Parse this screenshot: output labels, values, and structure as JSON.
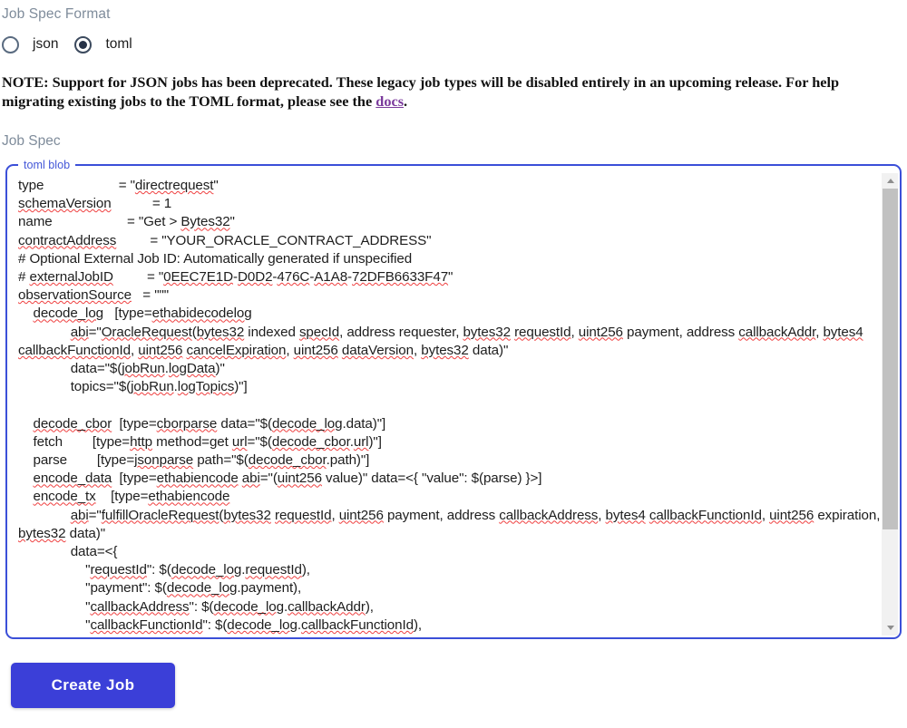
{
  "form": {
    "format_label": "Job Spec Format",
    "radios": [
      {
        "value": "json",
        "label": "json",
        "checked": false
      },
      {
        "value": "toml",
        "label": "toml",
        "checked": true
      }
    ],
    "note_part1": "NOTE: Support for JSON jobs has been deprecated. These legacy job types will be disabled entirely in an upcoming release. For help migrating existing jobs to the TOML format, please see the ",
    "note_link": "docs",
    "note_part2": ".",
    "jobspec_label": "Job Spec",
    "fieldset_legend": "toml blob",
    "submit_label": "Create Job"
  },
  "colors": {
    "accent_border": "#3b4fd8",
    "button_bg": "#3b3fd8",
    "label_gray": "#7f8c9b",
    "link_purple": "#7a3a9c",
    "spellcheck_red": "#ef3f3f",
    "scrollbar_thumb": "#c1c1c1",
    "scrollbar_track": "#f1f1f1"
  },
  "scrollbar": {
    "up_arrow_icon": "triangle-up-icon",
    "down_arrow_icon": "triangle-down-icon",
    "thumb_top_percent": 0,
    "thumb_size_percent": 79
  },
  "toml": {
    "lines": [
      "type                    = \"directrequest\"",
      "schemaVersion           = 1",
      "name                    = \"Get > Bytes32\"",
      "contractAddress         = \"YOUR_ORACLE_CONTRACT_ADDRESS\"",
      "# Optional External Job ID: Automatically generated if unspecified",
      "# externalJobID         = \"0EEC7E1D-D0D2-476C-A1A8-72DFB6633F47\"",
      "observationSource   = \"\"\"",
      "    decode_log   [type=ethabidecodelog",
      "              abi=\"OracleRequest(bytes32 indexed specId, address requester, bytes32 requestId, uint256 payment, address callbackAddr, bytes4 callbackFunctionId, uint256 cancelExpiration, uint256 dataVersion, bytes32 data)\"",
      "              data=\"$(jobRun.logData)\"",
      "              topics=\"$(jobRun.logTopics)\"]",
      "",
      "    decode_cbor  [type=cborparse data=\"$(decode_log.data)\"]",
      "    fetch        [type=http method=get url=\"$(decode_cbor.url)\"]",
      "    parse        [type=jsonparse path=\"$(decode_cbor.path)\"]",
      "    encode_data  [type=ethabiencode abi=\"(uint256 value)\" data=<{ \"value\": $(parse) }>]",
      "    encode_tx    [type=ethabiencode",
      "              abi=\"fulfillOracleRequest(bytes32 requestId, uint256 payment, address callbackAddress, bytes4 callbackFunctionId, uint256 expiration, bytes32 data)\"",
      "              data=<{",
      "                  \"requestId\": $(decode_log.requestId),",
      "                  \"payment\": $(decode_log.payment),",
      "                  \"callbackAddress\": $(decode_log.callbackAddr),",
      "                  \"callbackFunctionId\": $(decode_log.callbackFunctionId),"
    ]
  }
}
